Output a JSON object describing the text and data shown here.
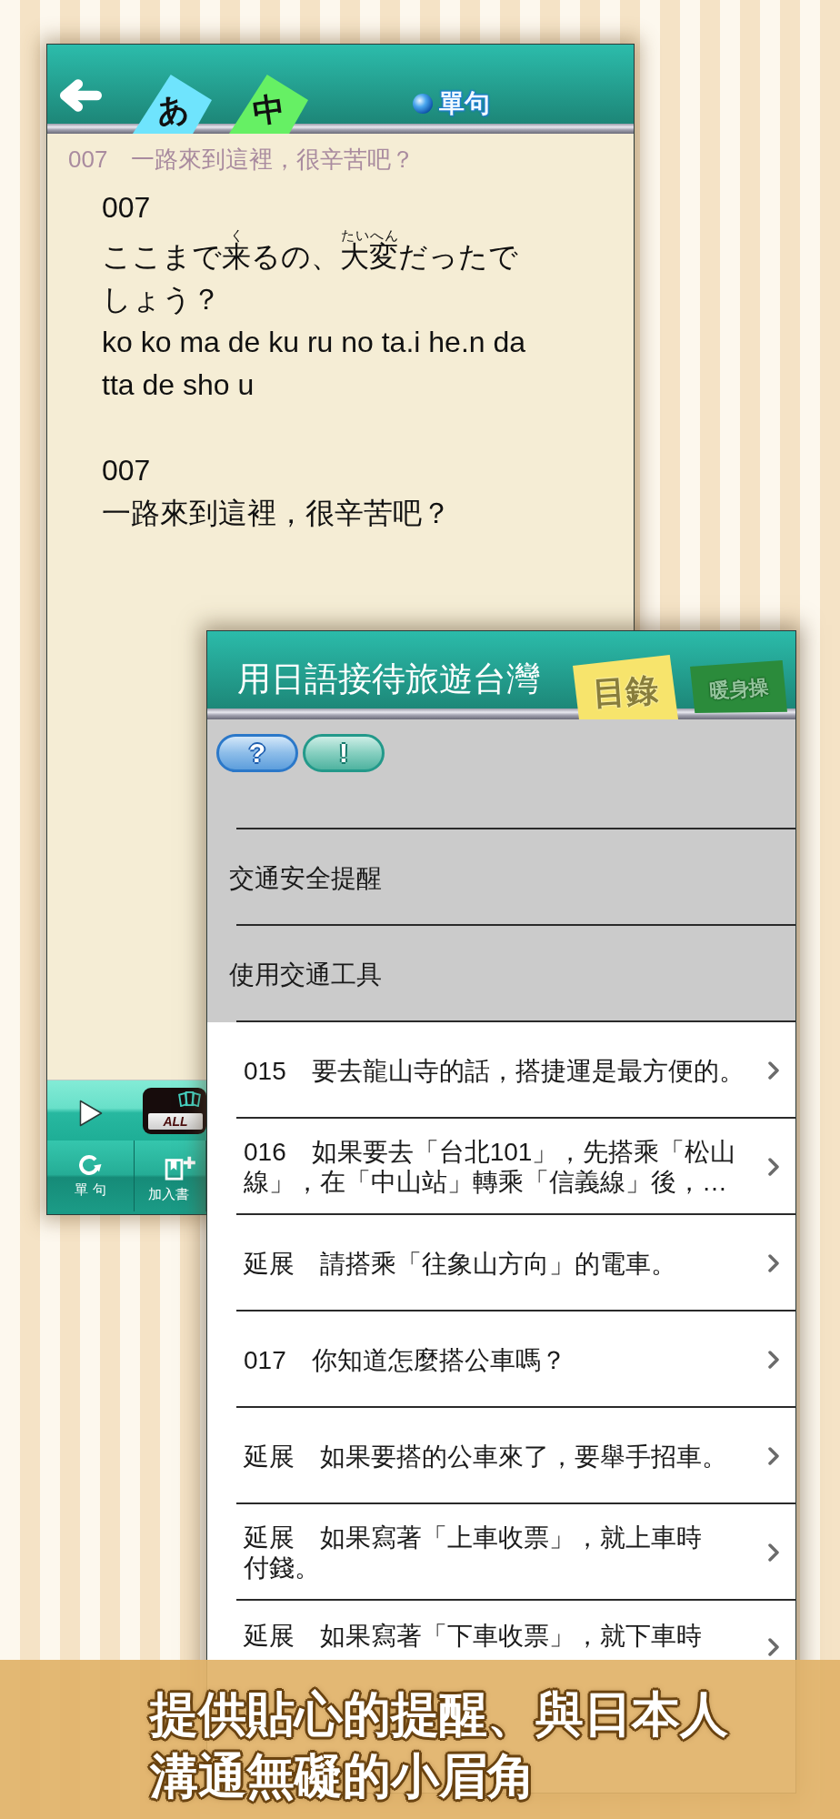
{
  "back_screen": {
    "tabs": [
      {
        "label": "あ",
        "color": "#6fe4fd"
      },
      {
        "label": "中",
        "color": "#66f064"
      }
    ],
    "mode_label": "單句",
    "subtitle": "007　一路來到這裡，很辛苦吧？",
    "passages": [
      {
        "kind": "japanese",
        "number": "007",
        "segments": [
          {
            "text": "ここまで"
          },
          {
            "text": "来",
            "ruby": "く"
          },
          {
            "text": "るの、"
          },
          {
            "text": "大変",
            "ruby": "たいへん"
          },
          {
            "text": "だったでしょう？"
          }
        ],
        "romaji": "ko ko ma de ku ru no ta.i he.n da tta de sho u"
      },
      {
        "kind": "chinese",
        "number": "007",
        "text": "一路來到這裡，很辛苦吧？"
      }
    ],
    "player": {
      "repeat_label": "ALL"
    },
    "toolbar": [
      {
        "kind": "mode",
        "label": "單 句"
      },
      {
        "kind": "bookmark",
        "label": "加入書"
      }
    ]
  },
  "front_screen": {
    "title": "用日語接待旅遊台灣",
    "tabs": [
      {
        "label": "目錄",
        "color": "#f7e46c",
        "selected": true
      },
      {
        "label": "暖身操",
        "color": "#2b8b3b",
        "selected": false
      }
    ],
    "pill_buttons": [
      {
        "kind": "help",
        "label": "?"
      },
      {
        "kind": "info",
        "label": "!"
      }
    ],
    "rows": [
      {
        "kind": "section",
        "lines": [
          "交通安全提醒"
        ]
      },
      {
        "kind": "section",
        "lines": [
          "使用交通工具"
        ]
      },
      {
        "kind": "item",
        "lines": [
          "015　要去龍山寺的話，搭捷運是最方便的。"
        ]
      },
      {
        "kind": "item",
        "lines": [
          "016　如果要去「台北101」，先搭乘「松山",
          "線」，在「中山站」轉乘「信義線」後，…"
        ]
      },
      {
        "kind": "item",
        "lines": [
          "延展　請搭乘「往象山方向」的電車。"
        ]
      },
      {
        "kind": "item",
        "lines": [
          "017　你知道怎麼搭公車嗎？"
        ]
      },
      {
        "kind": "item",
        "lines": [
          "延展　如果要搭的公車來了，要舉手招車。"
        ]
      },
      {
        "kind": "item",
        "lines": [
          "延展　如果寫著「上車收票」，就上車時",
          "付錢。"
        ]
      },
      {
        "kind": "item",
        "lines": [
          "延展　如果寫著「下車收票」，就下車時"
        ]
      }
    ]
  },
  "banner": {
    "lines": [
      "提供貼心的提醒、與日本人",
      "溝通無礙的小眉角"
    ]
  }
}
